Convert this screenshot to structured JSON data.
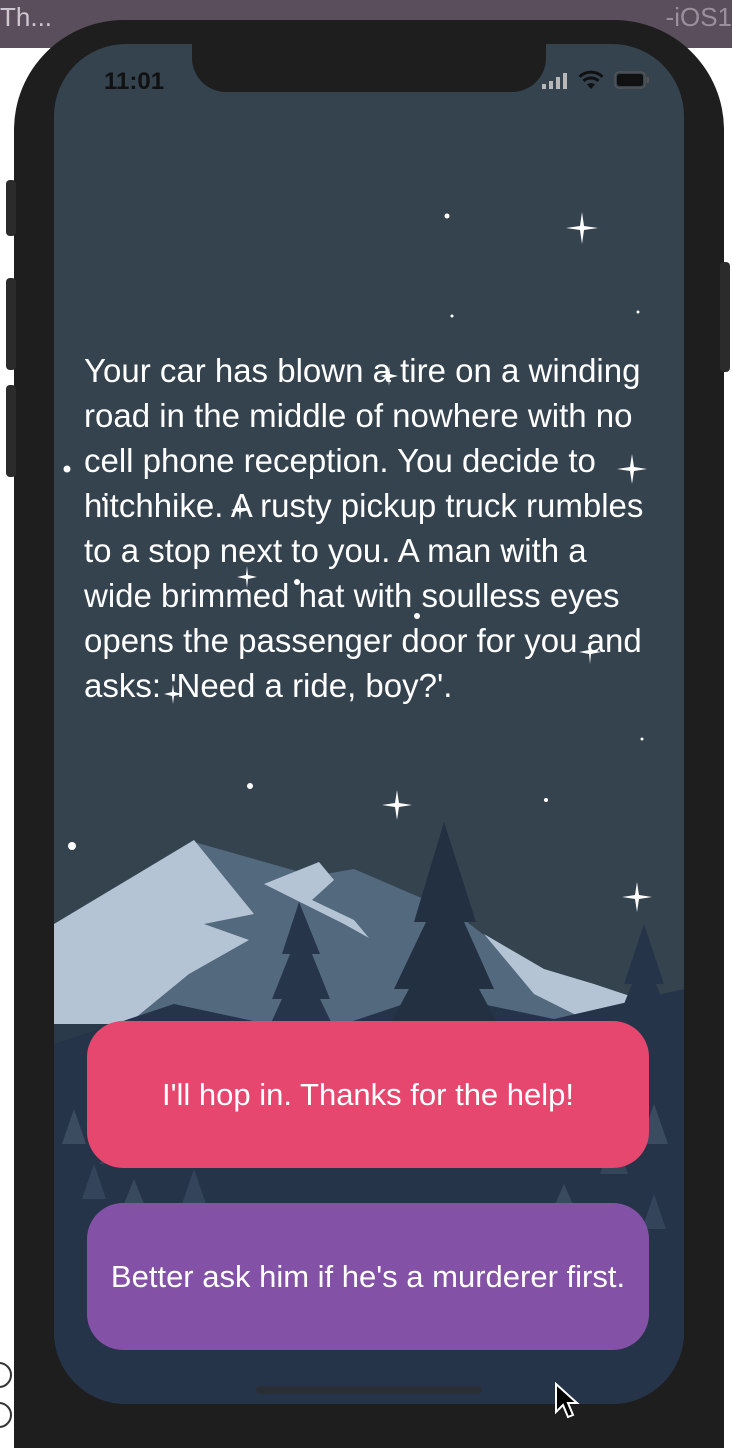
{
  "host": {
    "left_label": "Th...",
    "right_label": "-iOS1"
  },
  "status_bar": {
    "time": "11:01",
    "icons": [
      "cellular-signal-icon",
      "wifi-icon",
      "battery-icon"
    ]
  },
  "story": {
    "text": "Your car has blown a tire on a winding road in the middle of nowhere with no cell phone reception. You decide to hitchhike. A rusty pickup truck rumbles to a stop next to you. A man with a wide brimmed hat with soulless eyes opens the passenger door for you and asks: 'Need a ride, boy?'."
  },
  "choices": {
    "choice1": "I'll hop in. Thanks for the help!",
    "choice2": "Better ask him if he's a murderer first."
  },
  "colors": {
    "background": "#35434f",
    "choice1": "#e5476e",
    "choice2": "#8351a6",
    "text": "#ffffff"
  }
}
